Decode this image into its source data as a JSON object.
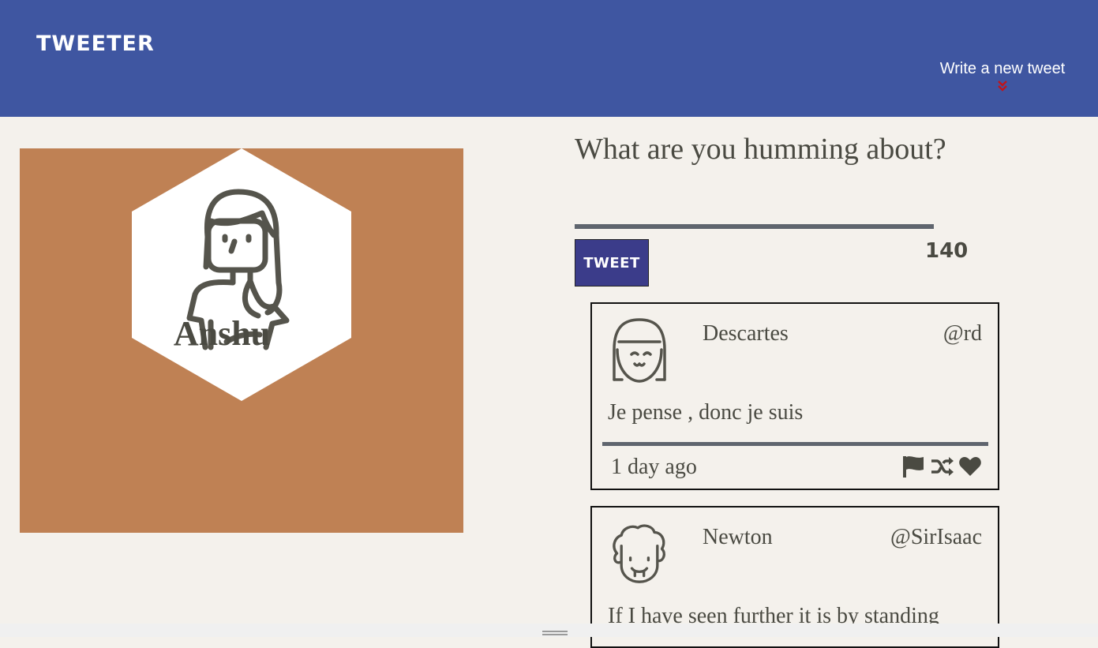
{
  "header": {
    "brand": "TWEETER",
    "compose_toggle_label": "Write a new tweet",
    "compose_toggle_icon": "double-chevron-down-icon",
    "background_color": "#3f56a1",
    "accent_color": "#c0141a"
  },
  "profile": {
    "name": "Anshu",
    "avatar_icon": "woman-avatar-icon",
    "card_color": "#bf8154"
  },
  "composer": {
    "heading": "What are you humming about?",
    "input_value": "",
    "submit_label": "TWEET",
    "char_count": "140",
    "button_color": "#3b3c8a"
  },
  "tweets": [
    {
      "author": "Descartes",
      "handle": "@rd",
      "content": "Je pense , donc je suis",
      "time": "1 day ago",
      "avatar_icon": "girl-avatar-icon",
      "actions": [
        "flag-icon",
        "retweet-icon",
        "heart-icon"
      ]
    },
    {
      "author": "Newton",
      "handle": "@SirIsaac",
      "content": "If I have seen further it is by standing",
      "avatar_icon": "curly-hair-avatar-icon"
    }
  ]
}
